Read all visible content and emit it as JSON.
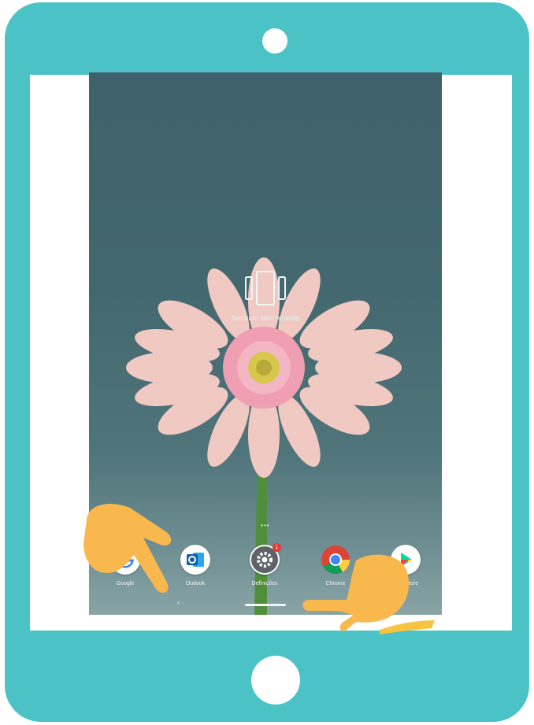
{
  "device": {
    "frame_color": "#4bc3c6",
    "camera_icon": "camera-dot",
    "home_button_icon": "home-button"
  },
  "overview": {
    "empty_message": "Nenhum item recente",
    "icon": "recents-empty-icon"
  },
  "home_screen": {
    "page_indicator": "•••"
  },
  "dock": {
    "apps": [
      {
        "label": "Google",
        "icon": "google-icon"
      },
      {
        "label": "Outlook",
        "icon": "outlook-icon"
      },
      {
        "label": "Definições",
        "icon": "settings-icon",
        "badge": "1"
      },
      {
        "label": "Chrome",
        "icon": "chrome-icon"
      },
      {
        "label": "Play Store",
        "icon": "play-store-icon"
      }
    ]
  },
  "nav": {
    "back_glyph": "‹"
  },
  "gestures": {
    "hand_color": "#f8b84e",
    "swipe_hand_color": "#f6c343"
  }
}
